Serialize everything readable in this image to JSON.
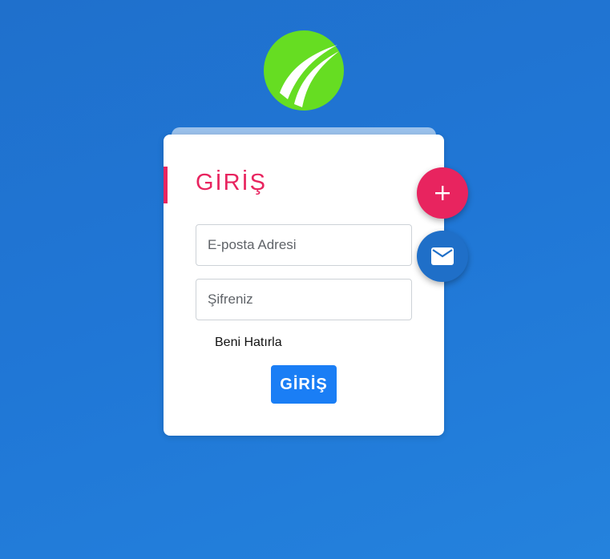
{
  "login": {
    "title": "GİRİŞ",
    "email_placeholder": "E-posta Adresi",
    "password_placeholder": "Şifreniz",
    "remember_label": "Beni Hatırla",
    "submit_label": "GİRİŞ"
  },
  "fabs": {
    "add_icon": "plus-icon",
    "mail_icon": "envelope-icon"
  },
  "colors": {
    "accent": "#e8245f",
    "primary_button": "#1a7ef5",
    "logo_green": "#66dd22",
    "background": "#2077d6"
  }
}
